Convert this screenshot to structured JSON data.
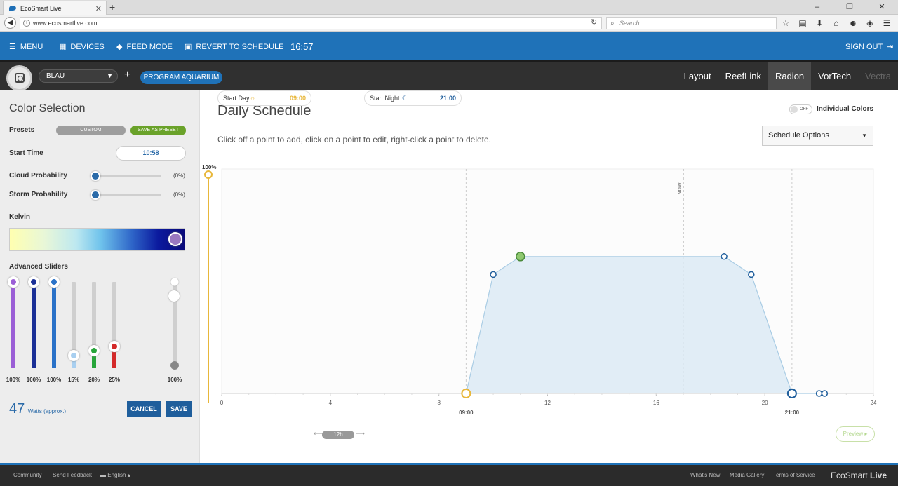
{
  "browser": {
    "tab_title": "EcoSmart Live",
    "url": "www.ecosmartlive.com",
    "search_placeholder": "Search"
  },
  "appbar": {
    "menu_label": "MENU",
    "devices_label": "DEVICES",
    "feed_label": "FEED MODE",
    "revert_label": "REVERT TO SCHEDULE",
    "clock": "16:57",
    "signout_label": "SIGN OUT"
  },
  "devicebar": {
    "device_name": "BLAU",
    "program_label": "PROGRAM AQUARIUM",
    "tabs": [
      "Layout",
      "ReefLink",
      "Radion",
      "VorTech",
      "Vectra"
    ],
    "active_tab": "Radion"
  },
  "color_selection": {
    "title": "Color Selection",
    "presets_label": "Presets",
    "preset_custom": "CUSTOM",
    "save_preset": "SAVE AS PRESET",
    "start_time_label": "Start Time",
    "start_time": "10:58",
    "cloud_label": "Cloud Probability",
    "cloud_value": "(0%)",
    "cloud_level": 0,
    "storm_label": "Storm Probability",
    "storm_value": "(0%)",
    "storm_level": 0,
    "kelvin_label": "Kelvin",
    "advanced_label": "Advanced Sliders",
    "sliders": [
      {
        "pct": "100%",
        "level": 1.0,
        "color": "#9b5fd6"
      },
      {
        "pct": "100%",
        "level": 1.0,
        "color": "#1a2f96"
      },
      {
        "pct": "100%",
        "level": 1.0,
        "color": "#2a72c8"
      },
      {
        "pct": "15%",
        "level": 0.15,
        "color": "#a8cff0"
      },
      {
        "pct": "20%",
        "level": 0.2,
        "color": "#27a53a"
      },
      {
        "pct": "25%",
        "level": 0.25,
        "color": "#d42a2a"
      }
    ],
    "master": {
      "pct": "100%",
      "level": 1.0
    },
    "watts": "47",
    "watts_unit": "Watts (approx.)",
    "cancel_label": "CANCEL",
    "save_label": "SAVE"
  },
  "schedule": {
    "title": "Daily Schedule",
    "toggle_state": "OFF",
    "individual_colors": "Individual Colors",
    "options_label": "Schedule Options",
    "hint": "Click off a point to add, click on a point to edit, right-click a point to delete.",
    "start_day_label": "Start Day",
    "start_day_time": "09:00",
    "duration": "12h",
    "start_night_label": "Start Night",
    "start_night_time": "21:00",
    "preview_label": "Preview"
  },
  "chart_data": {
    "type": "area",
    "x_ticks": [
      0,
      4,
      8,
      12,
      16,
      20,
      24
    ],
    "xlim": [
      0,
      24
    ],
    "ylim": [
      0,
      100
    ],
    "y_max_label": "100%",
    "now_label": "NOW",
    "now_hour": 17,
    "day_start_hour": 9,
    "day_start_label": "09:00",
    "night_start_hour": 21,
    "night_start_label": "21:00",
    "points": [
      {
        "x": 9.0,
        "y": 0
      },
      {
        "x": 10.0,
        "y": 53
      },
      {
        "x": 11.0,
        "y": 61
      },
      {
        "x": 18.5,
        "y": 61
      },
      {
        "x": 19.5,
        "y": 53
      },
      {
        "x": 21.0,
        "y": 0
      },
      {
        "x": 22.0,
        "y": 0
      },
      {
        "x": 22.2,
        "y": 0
      }
    ],
    "selected_point_index": 2,
    "colors": {
      "fill": "#dceaf5",
      "line": "#a9cce4",
      "accent": "#e8b73a",
      "selected": "#8fc86f"
    }
  },
  "footer": {
    "community": "Community",
    "feedback": "Send Feedback",
    "language": "English",
    "whats_new": "What's New",
    "media": "Media Gallery",
    "terms": "Terms of Service",
    "brand_a": "EcoSmart",
    "brand_b": "Live"
  }
}
